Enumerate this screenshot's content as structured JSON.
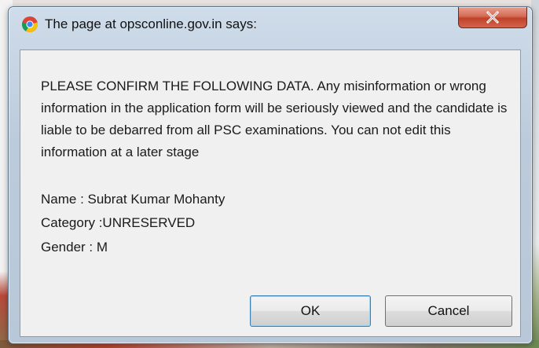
{
  "dialog": {
    "title": "The page at opsconline.gov.in says:",
    "title_icon": "chrome-icon",
    "close_icon": "close-x-icon",
    "message": "PLEASE CONFIRM THE FOLLOWING DATA. Any misinformation or wrong information in the application form will be seriously viewed and the candidate is liable to be debarred from all PSC examinations. You can not edit this information at a later stage",
    "details": {
      "name": "Name : Subrat Kumar Mohanty",
      "category": "Category :UNRESERVED",
      "gender": "Gender : M"
    },
    "buttons": {
      "ok_label": "OK",
      "cancel_label": "Cancel"
    }
  },
  "colors": {
    "close_button": "#c7472f",
    "frame": "#bccbdb",
    "default_button_border": "#3c7fb1"
  }
}
